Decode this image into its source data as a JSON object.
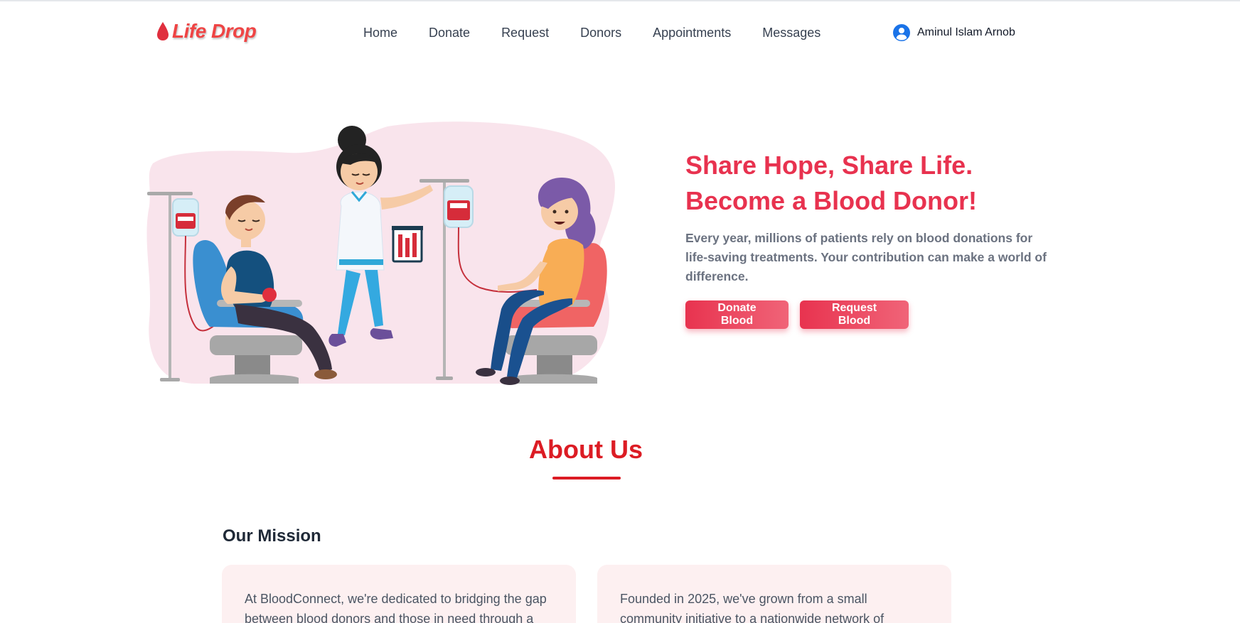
{
  "navbar": {
    "logo": {
      "text": "Life Drop",
      "icon": "blood-drop-icon"
    },
    "links": [
      "Home",
      "Donate",
      "Request",
      "Donors",
      "Appointments",
      "Messages"
    ],
    "user": {
      "name": "Aminul Islam Arnob",
      "icon": "user-avatar-icon"
    }
  },
  "hero": {
    "illustration": "blood-donation-illustration",
    "title_line1": "Share Hope, Share Life.",
    "title_line2": "Become a Blood Donor!",
    "desc_line1": "Every year, millions of patients rely on blood donations for",
    "desc_line2": "life-saving treatments. Your contribution can make a world of",
    "desc_line3": "difference.",
    "donate_button": "Donate Blood",
    "request_button": "Request Blood"
  },
  "about": {
    "title": "About Us",
    "mission_heading": "Our Mission",
    "cards": [
      {
        "line1": "At BloodConnect, we're dedicated to bridging the gap",
        "line2": "between blood donors and those in need through a"
      },
      {
        "line1": "Founded in 2025, we've grown from a small",
        "line2": "community initiative to a nationwide network of"
      }
    ]
  },
  "colors": {
    "brand_red": "#e8324f",
    "about_red": "#dc1c24",
    "card_bg": "#fdf0f1",
    "user_icon_blue": "#1a73e8"
  }
}
